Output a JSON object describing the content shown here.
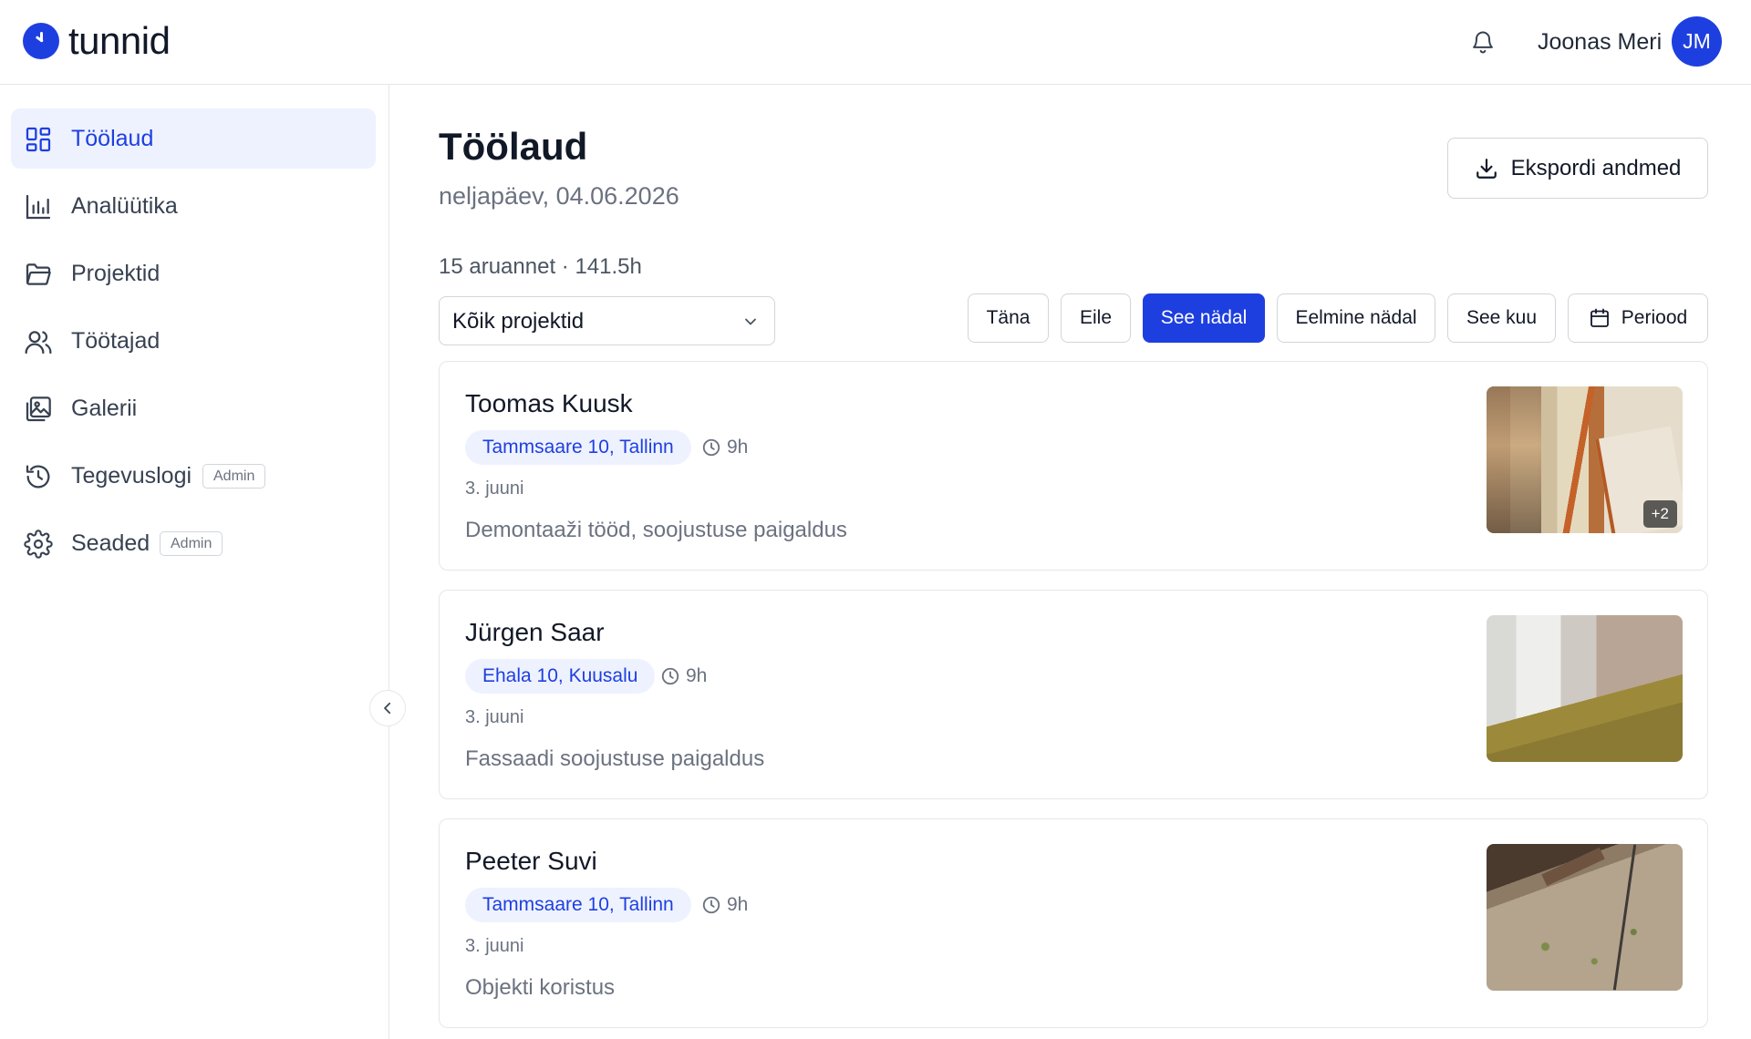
{
  "app": {
    "name": "tunnid"
  },
  "header": {
    "user_name": "Joonas Meri",
    "user_initials": "JM"
  },
  "sidebar": {
    "items": [
      {
        "label": "Töölaud",
        "icon": "dashboard-icon",
        "active": true
      },
      {
        "label": "Analüütika",
        "icon": "bar-chart-icon"
      },
      {
        "label": "Projektid",
        "icon": "folder-icon"
      },
      {
        "label": "Töötajad",
        "icon": "users-icon"
      },
      {
        "label": "Galerii",
        "icon": "gallery-icon"
      },
      {
        "label": "Tegevuslogi",
        "icon": "history-icon",
        "badge": "Admin"
      },
      {
        "label": "Seaded",
        "icon": "gear-icon",
        "badge": "Admin"
      }
    ]
  },
  "main": {
    "title": "Töölaud",
    "date": "neljapäev, 04.06.2026",
    "export_label": "Ekspordi andmed",
    "summary": "15 aruannet · 141.5h",
    "project_filter": "Kõik projektid",
    "period_filters": [
      {
        "label": "Täna"
      },
      {
        "label": "Eile"
      },
      {
        "label": "See nädal",
        "active": true
      },
      {
        "label": "Eelmine nädal"
      },
      {
        "label": "See kuu"
      },
      {
        "label": "Periood",
        "icon": "calendar-icon"
      }
    ]
  },
  "reports": [
    {
      "name": "Toomas Kuusk",
      "location": "Tammsaare 10, Tallinn",
      "hours": "9h",
      "date": "3. juuni",
      "description": "Demontaaži tööd, soojustuse paigaldus",
      "extra_photos": "+2"
    },
    {
      "name": "Jürgen Saar",
      "location": "Ehala 10, Kuusalu",
      "hours": "9h",
      "date": "3. juuni",
      "description": "Fassaadi soojustuse paigaldus"
    },
    {
      "name": "Peeter Suvi",
      "location": "Tammsaare 10, Tallinn",
      "hours": "9h",
      "date": "3. juuni",
      "description": "Objekti koristus"
    }
  ],
  "colors": {
    "accent": "#1e3fe0",
    "accent_light": "#eef2ff",
    "text_muted": "#6b7280",
    "border": "#e5e7eb"
  }
}
